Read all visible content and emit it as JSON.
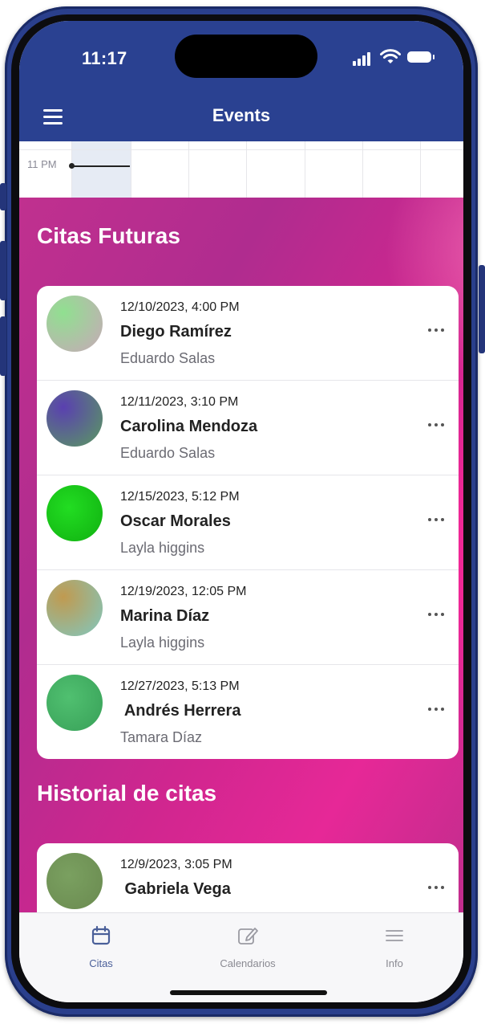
{
  "status_bar": {
    "time": "11:17",
    "icons": [
      "signal-icon",
      "wifi-icon",
      "battery-icon"
    ]
  },
  "header": {
    "title": "Events",
    "menu_icon": "hamburger-menu-icon"
  },
  "calendar": {
    "time_label": "11 PM"
  },
  "sections": {
    "upcoming_title": "Citas Futuras",
    "history_title": "Historial de citas"
  },
  "upcoming": [
    {
      "date": "12/10/2023, 4:00 PM",
      "name": "Diego Ramírez",
      "provider": "Eduardo Salas",
      "avatar_color": "#b8c99a"
    },
    {
      "date": "12/11/2023, 3:10 PM",
      "name": "Carolina Mendoza",
      "provider": "Eduardo Salas",
      "avatar_color": "#5a5aa0"
    },
    {
      "date": "12/15/2023, 5:12 PM",
      "name": "Oscar Morales",
      "provider": "Layla higgins",
      "avatar_color": "#1ecc1e"
    },
    {
      "date": "12/19/2023, 12:05 PM",
      "name": "Marina Díaz",
      "provider": "Layla higgins",
      "avatar_color": "#9aa88a"
    },
    {
      "date": "12/27/2023, 5:13 PM",
      "name": " Andrés Herrera",
      "provider": "Tamara Díaz",
      "avatar_color": "#48b068"
    }
  ],
  "history": [
    {
      "date": "12/9/2023, 3:05 PM",
      "name": " Gabriela Vega",
      "avatar_color": "#7a9a5e"
    }
  ],
  "tabs": [
    {
      "label": "Citas",
      "icon": "calendar-icon",
      "active": true
    },
    {
      "label": "Calendarios",
      "icon": "edit-icon",
      "active": false
    },
    {
      "label": "Info",
      "icon": "list-icon",
      "active": false
    }
  ],
  "colors": {
    "header": "#2a4191",
    "accent": "#4a5f99",
    "gradient_start": "#b52e8f",
    "gradient_end": "#e62897"
  }
}
